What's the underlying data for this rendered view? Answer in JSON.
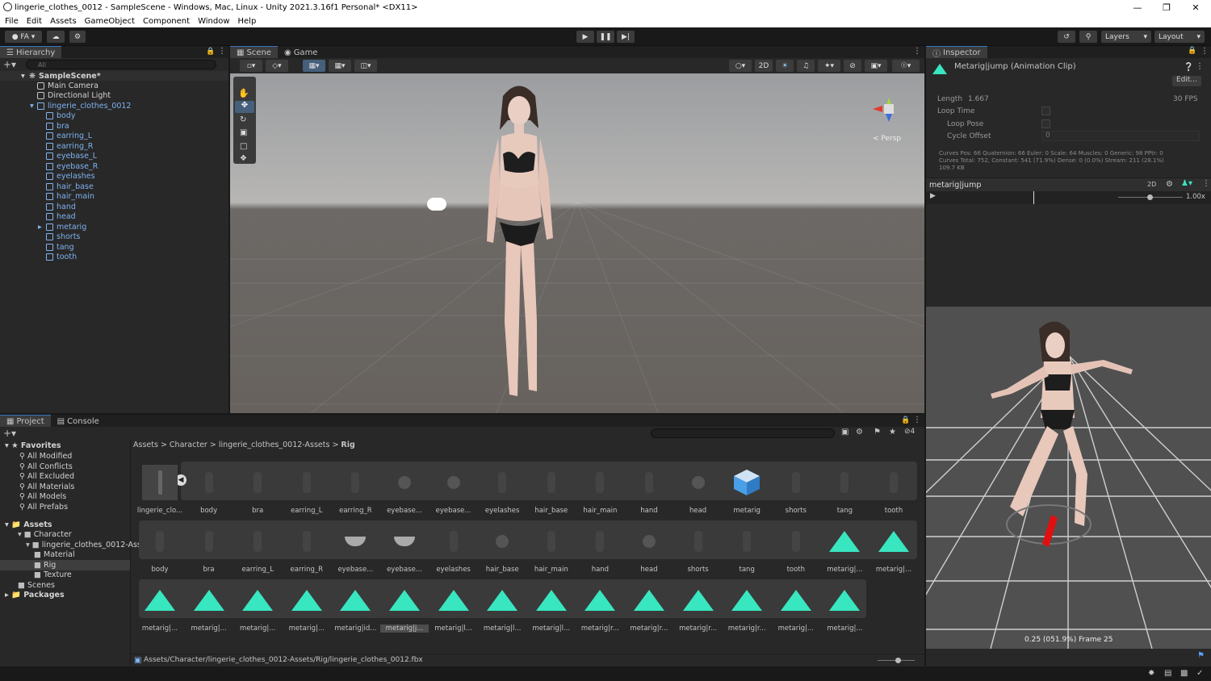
{
  "window": {
    "title": "lingerie_clothes_0012 - SampleScene - Windows, Mac, Linux - Unity 2021.3.16f1 Personal* <DX11>"
  },
  "menu": [
    "File",
    "Edit",
    "Assets",
    "GameObject",
    "Component",
    "Window",
    "Help"
  ],
  "toolbar": {
    "account": "FA",
    "layers": "Layers",
    "layout": "Layout"
  },
  "hierarchy": {
    "tab": "Hierarchy",
    "search_placeholder": "All",
    "scene": "SampleScene*",
    "items": [
      {
        "label": "Main Camera",
        "level": 1,
        "blue": false
      },
      {
        "label": "Directional Light",
        "level": 1,
        "blue": false
      },
      {
        "label": "lingerie_clothes_0012",
        "level": 1,
        "blue": true
      },
      {
        "label": "body",
        "level": 2,
        "blue": true
      },
      {
        "label": "bra",
        "level": 2,
        "blue": true
      },
      {
        "label": "earring_L",
        "level": 2,
        "blue": true
      },
      {
        "label": "earring_R",
        "level": 2,
        "blue": true
      },
      {
        "label": "eyebase_L",
        "level": 2,
        "blue": true
      },
      {
        "label": "eyebase_R",
        "level": 2,
        "blue": true
      },
      {
        "label": "eyelashes",
        "level": 2,
        "blue": true
      },
      {
        "label": "hair_base",
        "level": 2,
        "blue": true
      },
      {
        "label": "hair_main",
        "level": 2,
        "blue": true
      },
      {
        "label": "hand",
        "level": 2,
        "blue": true
      },
      {
        "label": "head",
        "level": 2,
        "blue": true
      },
      {
        "label": "metarig",
        "level": 2,
        "blue": true
      },
      {
        "label": "shorts",
        "level": 2,
        "blue": true
      },
      {
        "label": "tang",
        "level": 2,
        "blue": true
      },
      {
        "label": "tooth",
        "level": 2,
        "blue": true
      }
    ]
  },
  "scene_tabs": [
    "Scene",
    "Game"
  ],
  "scene": {
    "twod": "2D",
    "persp": "< Persp"
  },
  "inspector": {
    "tab": "Inspector",
    "title": "Metarig|jump (Animation Clip)",
    "edit": "Edit...",
    "length_label": "Length",
    "length_value": "1.667",
    "fps": "30 FPS",
    "loop_time": "Loop Time",
    "loop_pose": "Loop Pose",
    "cycle_offset": "Cycle Offset",
    "cycle_offset_value": "0",
    "stats1": "Curves Pos: 66 Quaternion: 66 Euler: 0 Scale: 64 Muscles: 0 Generic: 98 PPtr: 0",
    "stats2": "Curves Total: 752, Constant: 541 (71.9%) Dense: 0 (0.0%) Stream: 211 (28.1%)",
    "stats3": "109.7 KB",
    "preview_name": "metarig|jump",
    "preview_2d": "2D",
    "speed": "1.00x",
    "frame_info": "0.25 (051.9%) Frame 25"
  },
  "project": {
    "tabs": [
      "Project",
      "Console"
    ],
    "favorites_label": "Favorites",
    "favorites": [
      "All Modified",
      "All Conflicts",
      "All Excluded",
      "All Materials",
      "All Models",
      "All Prefabs"
    ],
    "assets_label": "Assets",
    "folders": [
      {
        "label": "Character",
        "level": 1
      },
      {
        "label": "lingerie_clothes_0012-Ass",
        "level": 2
      },
      {
        "label": "Material",
        "level": 3
      },
      {
        "label": "Rig",
        "level": 3
      },
      {
        "label": "Texture",
        "level": 3
      },
      {
        "label": "Scenes",
        "level": 1
      }
    ],
    "packages_label": "Packages",
    "breadcrumb": [
      "Assets",
      "Character",
      "lingerie_clothes_0012-Assets",
      "Rig"
    ],
    "hidden_count": "4",
    "row1": [
      "lingerie_clo...",
      "body",
      "bra",
      "earring_L",
      "earring_R",
      "eyebase...",
      "eyebase...",
      "eyelashes",
      "hair_base",
      "hair_main",
      "hand",
      "head",
      "metarig",
      "shorts",
      "tang",
      "tooth"
    ],
    "row2": [
      "body",
      "bra",
      "earring_L",
      "earring_R",
      "eyebase...",
      "eyebase...",
      "eyelashes",
      "hair_base",
      "hair_main",
      "hand",
      "head",
      "shorts",
      "tang",
      "tooth",
      "metarig|...",
      "metarig|..."
    ],
    "row3": [
      "metarig|...",
      "metarig|...",
      "metarig|...",
      "metarig|...",
      "metarig|id...",
      "metarig|j...",
      "metarig|l...",
      "metarig|l...",
      "metarig|l...",
      "metarig|r...",
      "metarig|r...",
      "metarig|r...",
      "metarig|r...",
      "metarig|...",
      "metarig|..."
    ],
    "path": "Assets/Character/lingerie_clothes_0012-Assets/Rig/lingerie_clothes_0012.fbx"
  },
  "colors": {
    "accent": "#3a79bb",
    "anim_clip": "#38e6c0",
    "selection": "#2c5d87"
  }
}
